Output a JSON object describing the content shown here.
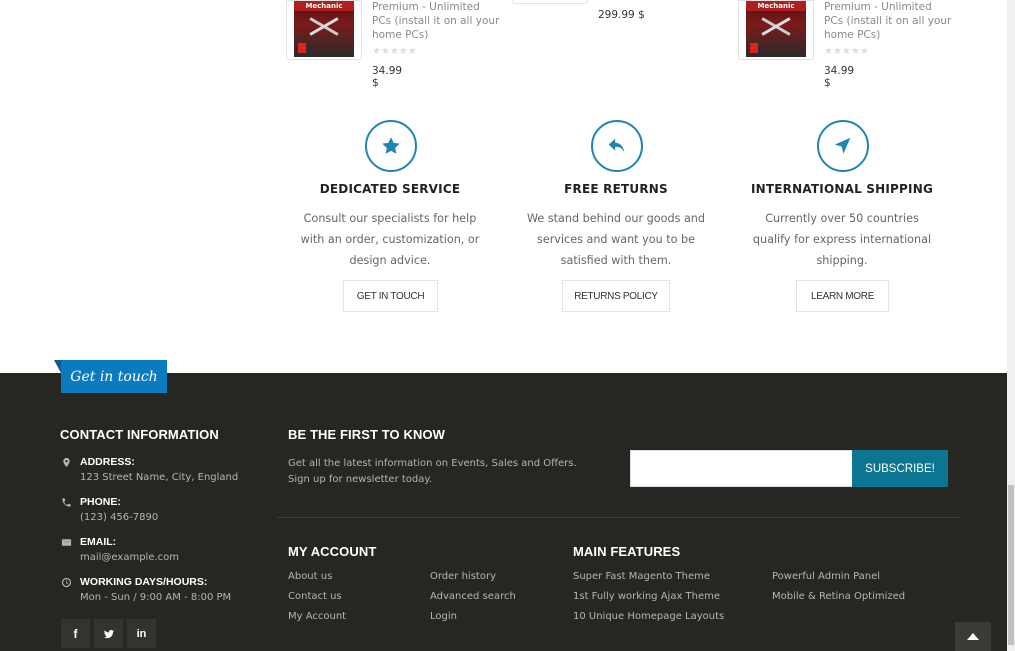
{
  "products": [
    {
      "cover_label": "Mechanic",
      "desc_lines": [
        "Premium - Unlimited",
        "PCs (install it on all your",
        "home PCs)"
      ],
      "stars": "★★★★★",
      "price": "34.99 $"
    },
    {
      "cover_label": "Mechanic",
      "desc_lines": [
        "Premium - Unlimited",
        "PCs (install it on all your",
        "home PCs)"
      ],
      "stars": "★★★★★",
      "price": "34.99 $"
    }
  ],
  "middle_price": "299.99 $",
  "features": [
    {
      "icon": "star-icon",
      "title": "DEDICATED SERVICE",
      "text_lines": [
        "Consult our specialists for help",
        "with an order, customization, or",
        "design advice."
      ],
      "button": "GET IN TOUCH"
    },
    {
      "icon": "reply-arrow-icon",
      "title": "FREE RETURNS",
      "text_lines": [
        "We stand behind our goods and",
        "services and want you to be",
        "satisfied with them."
      ],
      "button": "RETURNS POLICY"
    },
    {
      "icon": "location-arrow-icon",
      "title": "INTERNATIONAL SHIPPING",
      "text_lines": [
        "Currently over 50 countries",
        "qualify for express international",
        "shipping."
      ],
      "button": "LEARN MORE"
    }
  ],
  "footer": {
    "tab_label": "Get in touch",
    "contact": {
      "heading": "CONTACT INFORMATION",
      "items": [
        {
          "icon": "map-marker-icon",
          "label": "ADDRESS:",
          "value": "123 Street Name, City, England"
        },
        {
          "icon": "phone-icon",
          "label": "PHONE:",
          "value": "(123) 456-7890"
        },
        {
          "icon": "envelope-icon",
          "label": "EMAIL:",
          "value": "mail@example.com"
        },
        {
          "icon": "clock-icon",
          "label": "WORKING DAYS/HOURS:",
          "value": "Mon - Sun / 9:00 AM - 8:00 PM"
        }
      ],
      "social": [
        {
          "icon": "facebook-icon",
          "glyph": "f"
        },
        {
          "icon": "twitter-icon",
          "glyph": "t"
        },
        {
          "icon": "linkedin-icon",
          "glyph": "in"
        }
      ]
    },
    "newsletter": {
      "heading": "BE THE FIRST TO KNOW",
      "text_lines": [
        "Get all the latest information on Events, Sales and Offers.",
        "Sign up for newsletter today."
      ],
      "input_value": "",
      "input_placeholder": "",
      "button": "SUBSCRIBE!"
    },
    "my_account": {
      "heading": "MY ACCOUNT",
      "col1": [
        "About us",
        "Contact us",
        "My Account"
      ],
      "col2": [
        "Order history",
        "Advanced search",
        "Login"
      ]
    },
    "main_features": {
      "heading": "MAIN FEATURES",
      "col1": [
        "Super Fast Magento Theme",
        "1st Fully working Ajax Theme",
        "10 Unique Homepage Layouts"
      ],
      "col2": [
        "Powerful Admin Panel",
        "Mobile & Retina Optimized"
      ]
    }
  }
}
